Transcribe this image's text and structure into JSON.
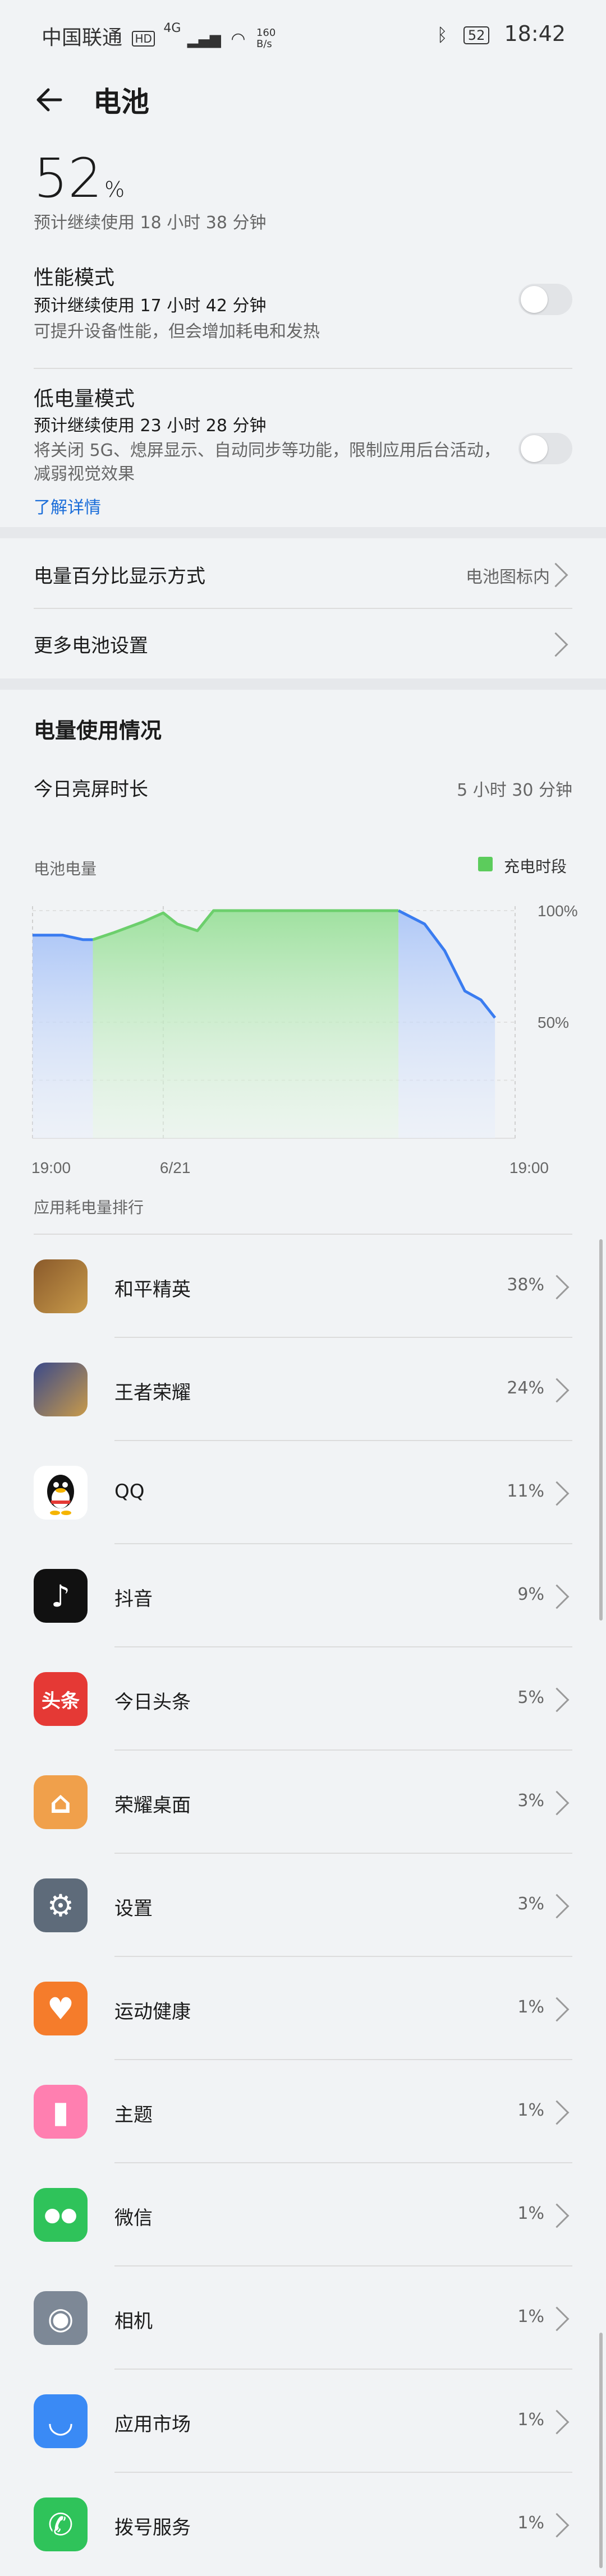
{
  "status_bar": {
    "carrier": "中国联通",
    "hd": "HD",
    "network": "4G",
    "speed_top": "160",
    "speed_bottom": "B/s",
    "battery": "52",
    "time": "18:42"
  },
  "header": {
    "title": "电池"
  },
  "battery": {
    "percent": "52",
    "unit": "%",
    "estimate": "预计继续使用 18 小时 38 分钟"
  },
  "performance_mode": {
    "title": "性能模式",
    "estimate": "预计继续使用 17 小时 42 分钟",
    "desc": "可提升设备性能，但会增加耗电和发热",
    "enabled": false
  },
  "low_power_mode": {
    "title": "低电量模式",
    "estimate": "预计继续使用 23 小时 28 分钟",
    "desc_line1": "将关闭 5G、熄屏显示、自动同步等功能，限制应用后台活动，",
    "desc_line2": "减弱视觉效果",
    "link": "了解详情",
    "enabled": false
  },
  "settings": {
    "percent_display": {
      "label": "电量百分比显示方式",
      "value": "电池图标内"
    },
    "more": {
      "label": "更多电池设置"
    }
  },
  "usage": {
    "title": "电量使用情况",
    "screen_time_label": "今日亮屏时长",
    "screen_time_value": "5 小时 30 分钟",
    "chart_label": "电池电量",
    "legend": "充电时段",
    "rank_title": "应用耗电量排行"
  },
  "chart_data": {
    "type": "area",
    "title": "电池电量",
    "x_tick_labels": [
      "19:00",
      "6/21",
      "19:00"
    ],
    "y_tick_labels": [
      "100%",
      "50%"
    ],
    "ylim": [
      0,
      100
    ],
    "x_range_hours": [
      0,
      24
    ],
    "series": [
      {
        "name": "电池电量",
        "points": [
          [
            0,
            89
          ],
          [
            1.5,
            89
          ],
          [
            2.5,
            87
          ],
          [
            3,
            87
          ],
          [
            4,
            90
          ],
          [
            5.5,
            95
          ],
          [
            6.5,
            99
          ],
          [
            7.2,
            94
          ],
          [
            8.2,
            91
          ],
          [
            9,
            100
          ],
          [
            18.2,
            100
          ],
          [
            19.5,
            94
          ],
          [
            20.5,
            82
          ],
          [
            21.5,
            64
          ],
          [
            22.3,
            60
          ],
          [
            23,
            52
          ]
        ]
      }
    ],
    "charging_periods": [
      [
        3,
        18.2
      ]
    ],
    "colors": {
      "line": "#3a7cf0",
      "charging_fill": "#6ccf6c",
      "legend": "#5ccc5c"
    }
  },
  "apps": [
    {
      "name": "和平精英",
      "percent": "38%",
      "icon": "game-icon",
      "color": "#8a5a2b",
      "glyph": ""
    },
    {
      "name": "王者荣耀",
      "percent": "24%",
      "icon": "game-icon",
      "color": "#3b4a8a",
      "glyph": ""
    },
    {
      "name": "QQ",
      "percent": "11%",
      "icon": "penguin-icon",
      "color": "#ffffff",
      "glyph": ""
    },
    {
      "name": "抖音",
      "percent": "9%",
      "icon": "music-note-icon",
      "color": "#111111",
      "glyph": "♪"
    },
    {
      "name": "今日头条",
      "percent": "5%",
      "icon": "news-icon",
      "color": "#e53935",
      "glyph": "头条"
    },
    {
      "name": "荣耀桌面",
      "percent": "3%",
      "icon": "home-icon",
      "color": "#f0a04b",
      "glyph": "⌂"
    },
    {
      "name": "设置",
      "percent": "3%",
      "icon": "gear-icon",
      "color": "#5e6b7a",
      "glyph": "⚙"
    },
    {
      "name": "运动健康",
      "percent": "1%",
      "icon": "heart-icon",
      "color": "#f57c2b",
      "glyph": "♥"
    },
    {
      "name": "主题",
      "percent": "1%",
      "icon": "brush-icon",
      "color": "#ff7fb0",
      "glyph": "▮"
    },
    {
      "name": "微信",
      "percent": "1%",
      "icon": "chat-icon",
      "color": "#2fc35a",
      "glyph": "●●"
    },
    {
      "name": "相机",
      "percent": "1%",
      "icon": "camera-icon",
      "color": "#7d8896",
      "glyph": "◉"
    },
    {
      "name": "应用市场",
      "percent": "1%",
      "icon": "bag-icon",
      "color": "#3a8af5",
      "glyph": "◡"
    },
    {
      "name": "拨号服务",
      "percent": "1%",
      "icon": "phone-icon",
      "color": "#2fc35a",
      "glyph": "✆"
    }
  ]
}
